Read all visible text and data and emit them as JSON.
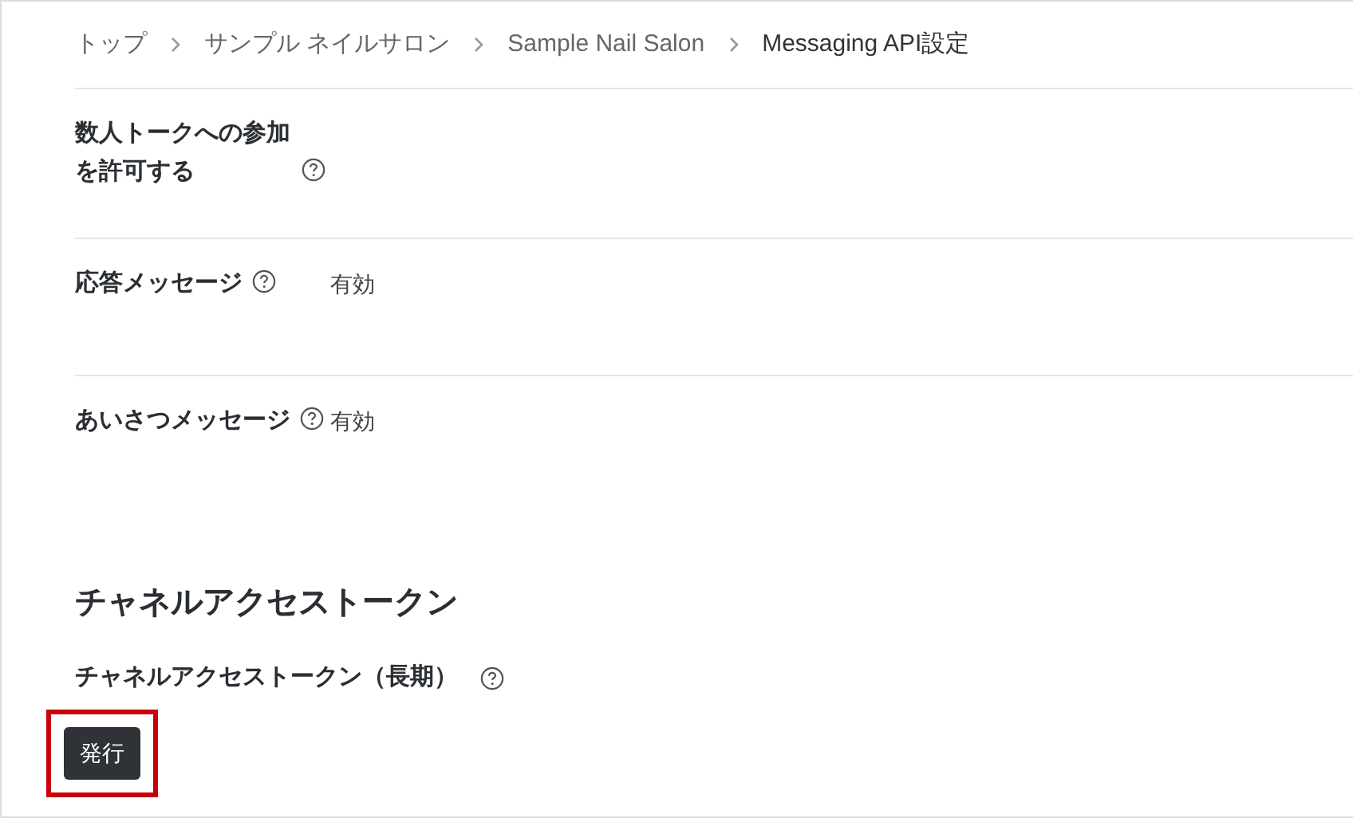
{
  "breadcrumb": [
    {
      "label": "トップ",
      "current": false
    },
    {
      "label": "サンプル ネイルサロン",
      "current": false
    },
    {
      "label": "Sample Nail Salon",
      "current": false
    },
    {
      "label": "Messaging API設定",
      "current": true
    }
  ],
  "settings": [
    {
      "label": "数人トークへの参加を許可する"
    },
    {
      "label": "応答メッセージ",
      "value": "有効"
    },
    {
      "label": "あいさつメッセージ",
      "value": "有効"
    }
  ],
  "section": {
    "title": "チャネルアクセストークン",
    "field": {
      "label": "チャネルアクセストークン（長期）"
    },
    "button": {
      "label": "発行",
      "highlighted": true
    }
  }
}
